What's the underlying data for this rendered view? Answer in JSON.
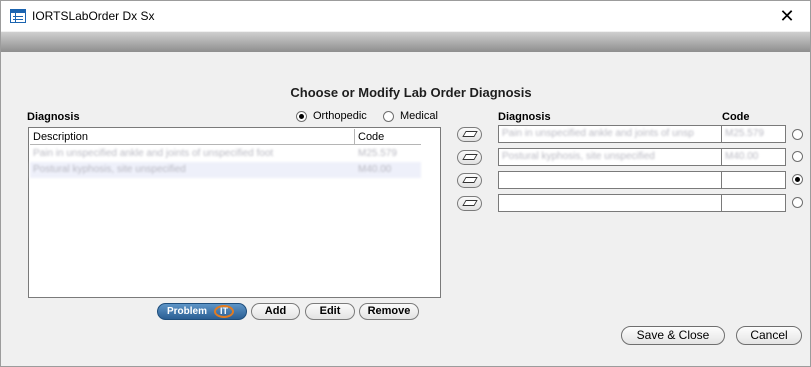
{
  "window": {
    "title": "IORTSLabOrder Dx Sx",
    "close_glyph": "✕"
  },
  "heading": "Choose or Modify Lab Order Diagnosis",
  "left": {
    "section_label": "Diagnosis",
    "radios": [
      {
        "label": "Orthopedic",
        "selected": true
      },
      {
        "label": "Medical",
        "selected": false
      }
    ],
    "columns": [
      "Description",
      "Code"
    ],
    "rows": [
      {
        "description": "Pain in unspecified ankle and joints of unspecified foot",
        "code": "M25.579"
      },
      {
        "description": "Postural kyphosis, site unspecified",
        "code": "M40.00"
      }
    ]
  },
  "buttons": {
    "problem_it_label": "Problem",
    "problem_it_badge": "IT",
    "add": "Add",
    "edit": "Edit",
    "remove": "Remove",
    "save_close": "Save & Close",
    "cancel": "Cancel"
  },
  "right": {
    "diagnosis_header": "Diagnosis",
    "code_header": "Code",
    "rows": [
      {
        "diagnosis": "Pain in unspecified ankle and joints of unsp",
        "code": "M25.579",
        "selected": false
      },
      {
        "diagnosis": "Postural kyphosis, site unspecified",
        "code": "M40.00",
        "selected": false
      },
      {
        "diagnosis": "",
        "code": "",
        "selected": true
      },
      {
        "diagnosis": "",
        "code": "",
        "selected": false
      }
    ]
  },
  "icons": {
    "app": "table-window-icon",
    "eraser": "eraser-icon"
  },
  "colors": {
    "problem_button": "#2b5f94",
    "problem_ring": "#e07b22",
    "alt_row": "#eef0fa"
  }
}
